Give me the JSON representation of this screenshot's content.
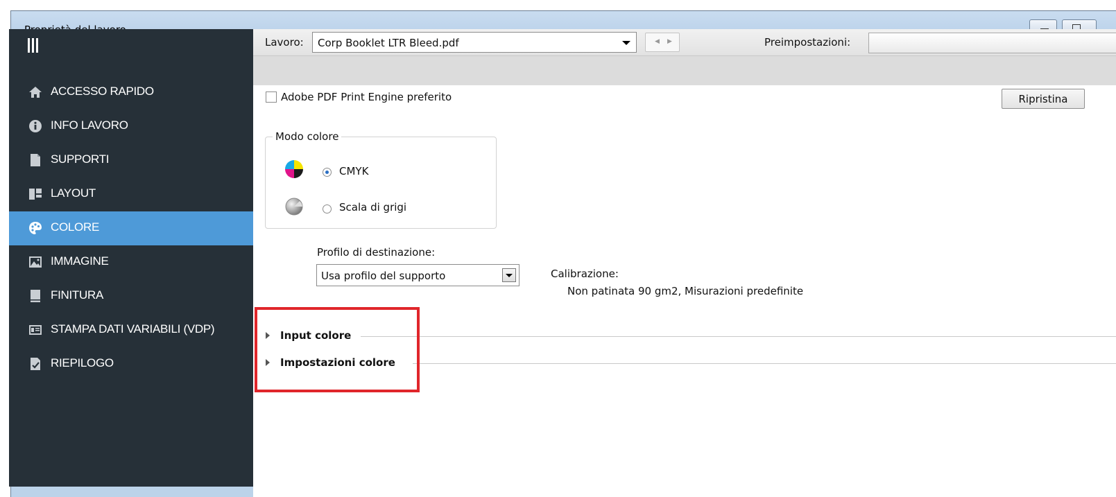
{
  "window": {
    "title": "Proprietà del lavoro"
  },
  "sidebar": {
    "items": [
      {
        "label": "ACCESSO RAPIDO",
        "icon": "home-icon"
      },
      {
        "label": "INFO LAVORO",
        "icon": "info-icon"
      },
      {
        "label": "SUPPORTI",
        "icon": "paper-icon"
      },
      {
        "label": "LAYOUT",
        "icon": "layout-icon"
      },
      {
        "label": "COLORE",
        "icon": "palette-icon",
        "active": true
      },
      {
        "label": "IMMAGINE",
        "icon": "image-icon"
      },
      {
        "label": "FINITURA",
        "icon": "book-icon"
      },
      {
        "label": "STAMPA DATI VARIABILI (VDP)",
        "icon": "vdp-icon"
      },
      {
        "label": "RIEPILOGO",
        "icon": "summary-icon"
      }
    ]
  },
  "jobbar": {
    "job_label": "Lavoro:",
    "job_value": "Corp Booklet LTR Bleed.pdf",
    "preset_label": "Preimpostazioni:",
    "preset_value": ""
  },
  "engine": {
    "checkbox_label": "Adobe PDF Print Engine preferito",
    "checked": false,
    "reset_label": "Ripristina"
  },
  "color_mode": {
    "title": "Modo colore",
    "options": [
      {
        "label": "CMYK",
        "selected": true
      },
      {
        "label": "Scala di grigi",
        "selected": false
      }
    ]
  },
  "profile": {
    "label": "Profilo di destinazione:",
    "value": "Usa profilo del supporto"
  },
  "calibration": {
    "label": "Calibrazione:",
    "value": "Non patinata 90 gm2, Misurazioni predefinite"
  },
  "sections": [
    {
      "title": "Input colore",
      "expanded": false
    },
    {
      "title": "Impostazioni colore",
      "expanded": false
    }
  ],
  "colors": {
    "sidebar_bg": "#263038",
    "active_item": "#4e9ad8",
    "highlight_border": "#e0262b",
    "titlebar": "#bcd3ea"
  }
}
